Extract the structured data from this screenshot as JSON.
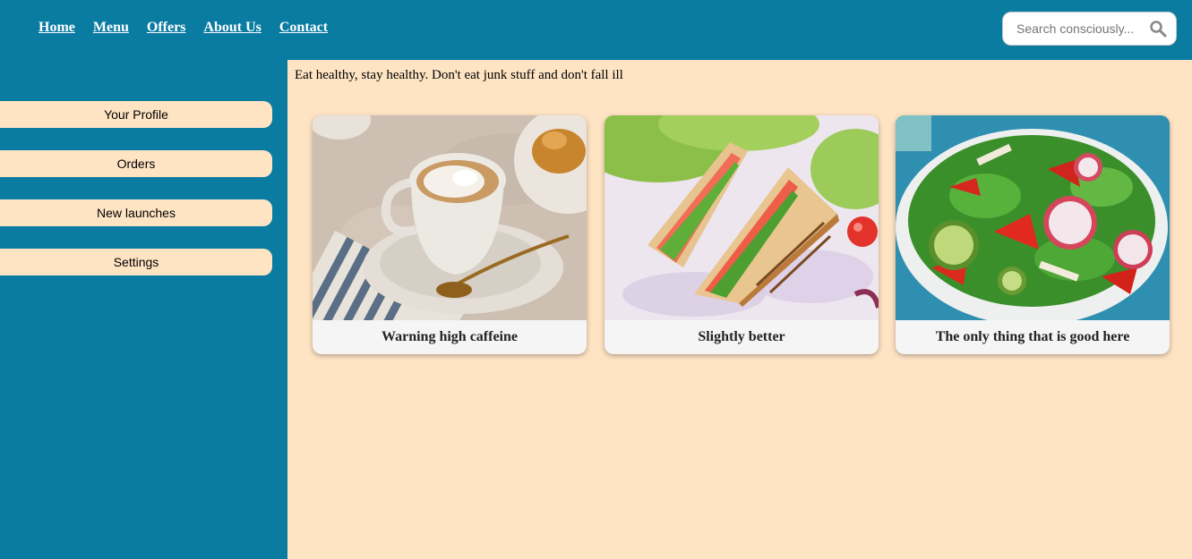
{
  "nav": {
    "items": [
      {
        "label": "Home"
      },
      {
        "label": "Menu"
      },
      {
        "label": "Offers"
      },
      {
        "label": "About Us"
      },
      {
        "label": "Contact"
      }
    ]
  },
  "search": {
    "placeholder": "Search consciously..."
  },
  "sidebar": {
    "items": [
      {
        "label": "Your Profile"
      },
      {
        "label": "Orders"
      },
      {
        "label": "New launches"
      },
      {
        "label": "Settings"
      }
    ]
  },
  "main": {
    "tagline": "Eat healthy, stay healthy. Don't eat junk stuff and don't fall ill",
    "cards": [
      {
        "caption": "Warning high caffeine",
        "image": "coffee-cup-photo"
      },
      {
        "caption": "Slightly better",
        "image": "sandwich-photo"
      },
      {
        "caption": "The only thing that is good here",
        "image": "salad-bowl-photo"
      }
    ]
  },
  "colors": {
    "header_bg": "#0a7ba1",
    "page_bg": "#ffe4c4",
    "card_bg": "#f6f5f5"
  }
}
